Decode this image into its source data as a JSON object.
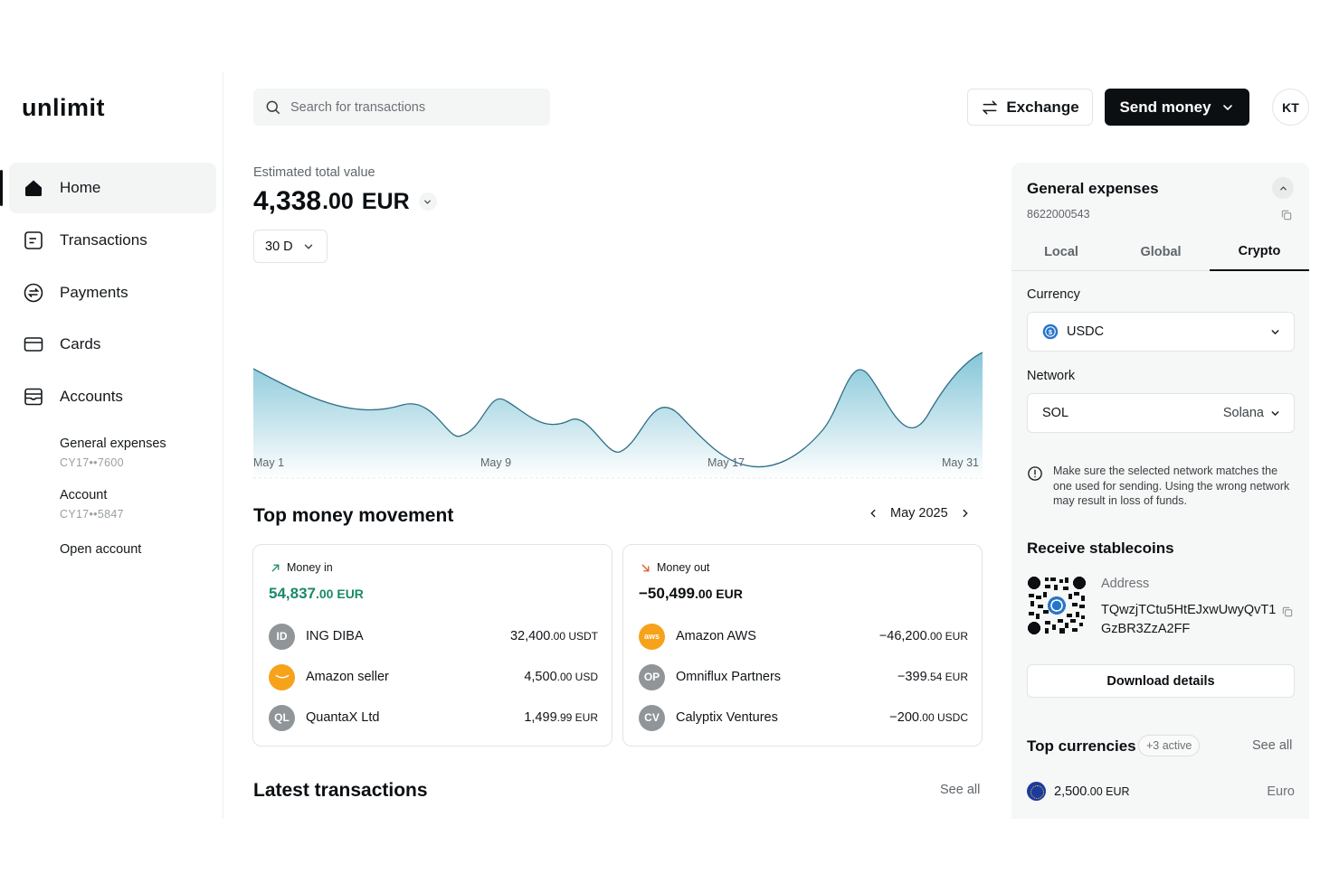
{
  "brand": {
    "logo": "unlimit"
  },
  "sidebar": {
    "items": [
      {
        "label": "Home",
        "icon": "home-icon",
        "active": true
      },
      {
        "label": "Transactions",
        "icon": "receipt-icon"
      },
      {
        "label": "Payments",
        "icon": "swap-circle-icon"
      },
      {
        "label": "Cards",
        "icon": "card-icon"
      },
      {
        "label": "Accounts",
        "icon": "wallet-icon"
      }
    ],
    "accounts": [
      {
        "name": "General expenses",
        "id": "CY17••7600"
      },
      {
        "name": "Account",
        "id": "CY17••5847"
      }
    ],
    "open_account": "Open account"
  },
  "header": {
    "search_placeholder": "Search for transactions",
    "exchange_label": "Exchange",
    "send_label": "Send money",
    "avatar_initials": "KT"
  },
  "summary": {
    "label": "Estimated total value",
    "integer": "4,338",
    "decimals": ".00",
    "currency": "EUR",
    "period": "30 D"
  },
  "chart_data": {
    "type": "area",
    "x": [
      "May 1",
      "May 9",
      "May 17",
      "May 31"
    ],
    "tick_labels": [
      "May 1",
      "May 9",
      "May 17",
      "May 31"
    ],
    "grid": true,
    "color": "#7ec3d6"
  },
  "movement": {
    "title": "Top money movement",
    "month": "May 2025",
    "money_in": {
      "label": "Money in",
      "total_int": "54,837",
      "total_dec": ".00 EUR",
      "color": "#1a8a6a",
      "rows": [
        {
          "initials": "ID",
          "name": "ING DIBA",
          "amt_int": "32,400",
          "amt_dec": ".00 USDT",
          "icon_color": "#8f9599"
        },
        {
          "initials": "",
          "name": "Amazon seller",
          "amt_int": "4,500",
          "amt_dec": ".00 USD",
          "icon_color": "#f6a21a"
        },
        {
          "initials": "QL",
          "name": "QuantaX Ltd",
          "amt_int": "1,499",
          "amt_dec": ".99 EUR",
          "icon_color": "#8f9599"
        }
      ]
    },
    "money_out": {
      "label": "Money out",
      "total_int": "−50,499",
      "total_dec": ".00 EUR",
      "color": "#e05a1f",
      "rows": [
        {
          "initials": "aws",
          "name": "Amazon AWS",
          "amt_int": "−46,200",
          "amt_dec": ".00 EUR",
          "icon_color": "#f6a21a"
        },
        {
          "initials": "OP",
          "name": "Omniflux Partners",
          "amt_int": "−399",
          "amt_dec": ".54 EUR",
          "icon_color": "#8f9599"
        },
        {
          "initials": "CV",
          "name": "Calyptix Ventures",
          "amt_int": "−200",
          "amt_dec": ".00 USDC",
          "icon_color": "#8f9599"
        }
      ]
    }
  },
  "latest": {
    "title": "Latest transactions",
    "see_all": "See all"
  },
  "panel": {
    "title": "General expenses",
    "account_number": "8622000543",
    "tabs": [
      {
        "label": "Local",
        "active": false
      },
      {
        "label": "Global",
        "active": false
      },
      {
        "label": "Crypto",
        "active": true
      }
    ],
    "currency_label": "Currency",
    "currency_value": "USDC",
    "network_label": "Network",
    "network_value": "SOL",
    "network_name": "Solana",
    "warning": "Make sure the selected network matches the one used for sending. Using the wrong network may result in loss of funds.",
    "receive_title": "Receive stablecoins",
    "address_label": "Address",
    "address": "TQwzjTCtu5HtEJxwUwyQvT1GzBR3ZzA2FF",
    "download_label": "Download details"
  },
  "top_currencies": {
    "title": "Top currencies",
    "badge": "+3 active",
    "see_all": "See all",
    "rows": [
      {
        "amt_int": "2,500",
        "amt_dec": ".00 EUR",
        "name": "Euro"
      }
    ]
  }
}
